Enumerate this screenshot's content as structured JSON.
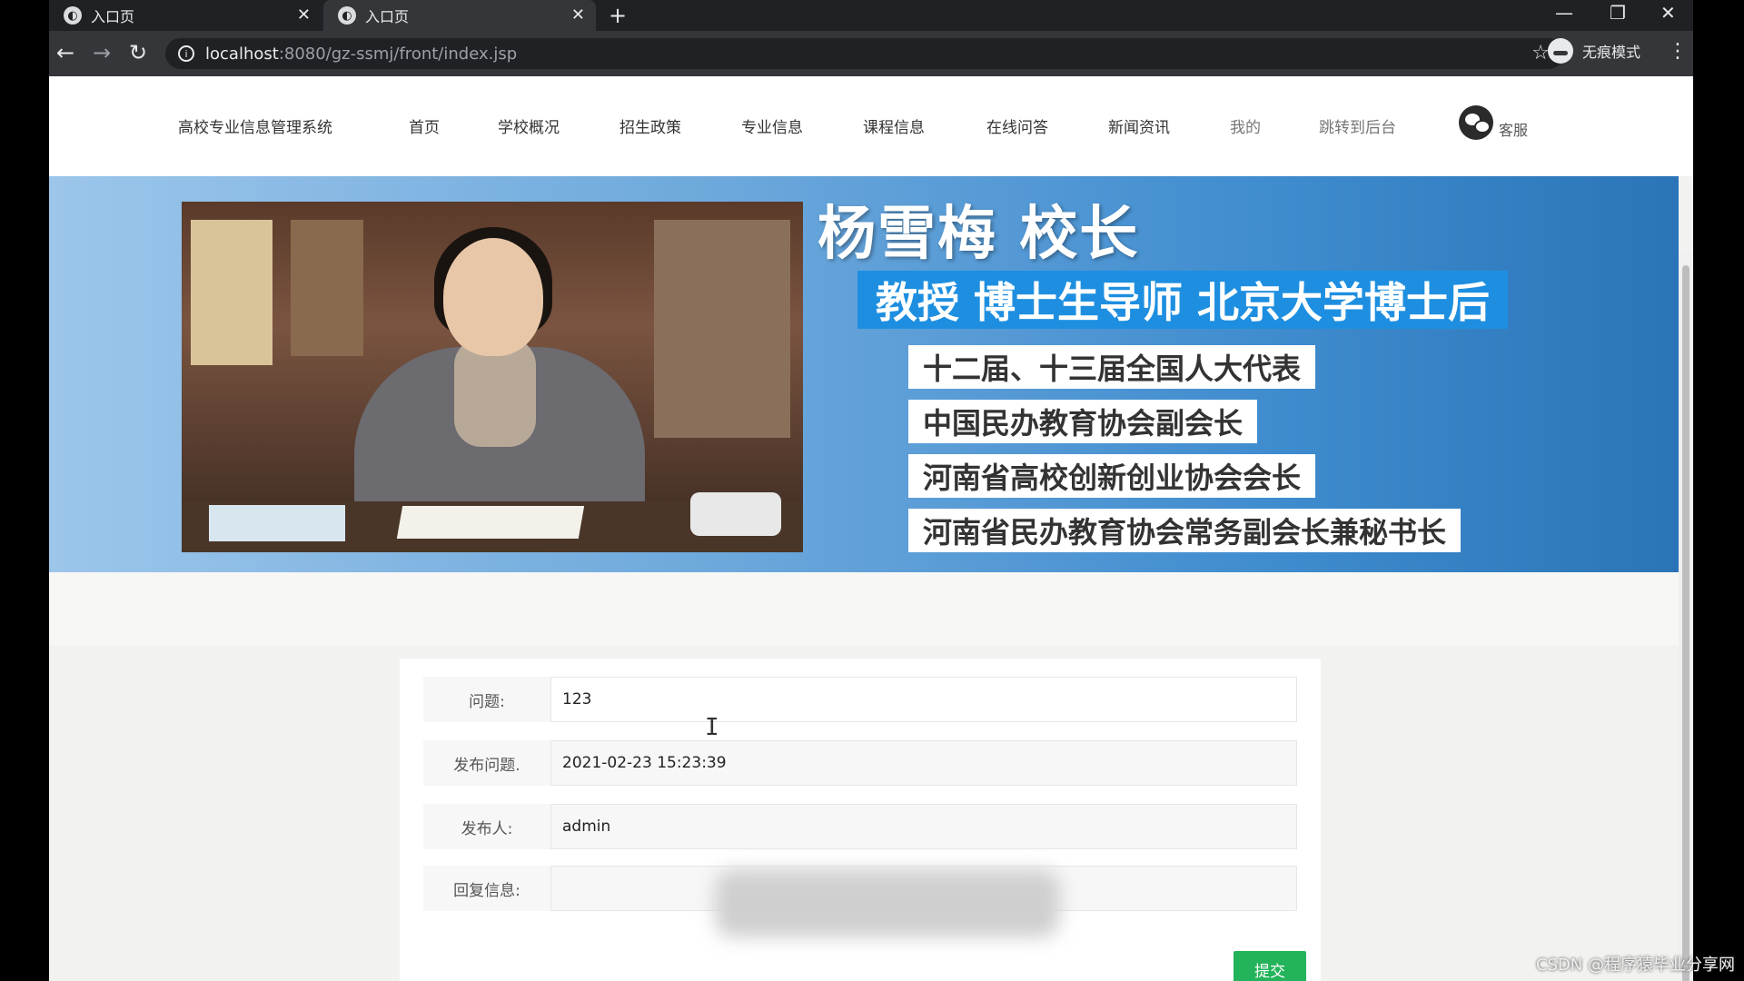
{
  "browser": {
    "tabs": [
      {
        "title": "入口页"
      },
      {
        "title": "入口页"
      }
    ],
    "new_tab": "+",
    "address": {
      "host": "localhost",
      "path": ":8080/gz-ssmj/front/index.jsp"
    },
    "incognito_label": "无痕模式"
  },
  "nav": {
    "brand": "高校专业信息管理系统",
    "items": [
      "首页",
      "学校概况",
      "招生政策",
      "专业信息",
      "课程信息",
      "在线问答",
      "新闻资讯"
    ],
    "mine": "我的",
    "admin_link": "跳转到后台",
    "service": "客服"
  },
  "banner": {
    "name": "杨雪梅 校长",
    "titles": "教授 博士生导师 北京大学博士后",
    "roles": [
      "十二届、十三届全国人大代表",
      "中国民办教育协会副会长",
      "河南省高校创新创业协会会长",
      "河南省民办教育协会常务副会长兼秘书长"
    ]
  },
  "form": {
    "question_label": "问题:",
    "question_value": "123",
    "published_label": "发布问题.",
    "published_value": "2021-02-23 15:23:39",
    "author_label": "发布人:",
    "author_value": "admin",
    "reply_label": "回复信息:",
    "reply_value": "",
    "submit_label": "提交"
  },
  "watermark": "CSDN @程序猿毕业分享网",
  "colors": {
    "submit": "#23b35a",
    "banner_accent": "#1e8fe0"
  }
}
